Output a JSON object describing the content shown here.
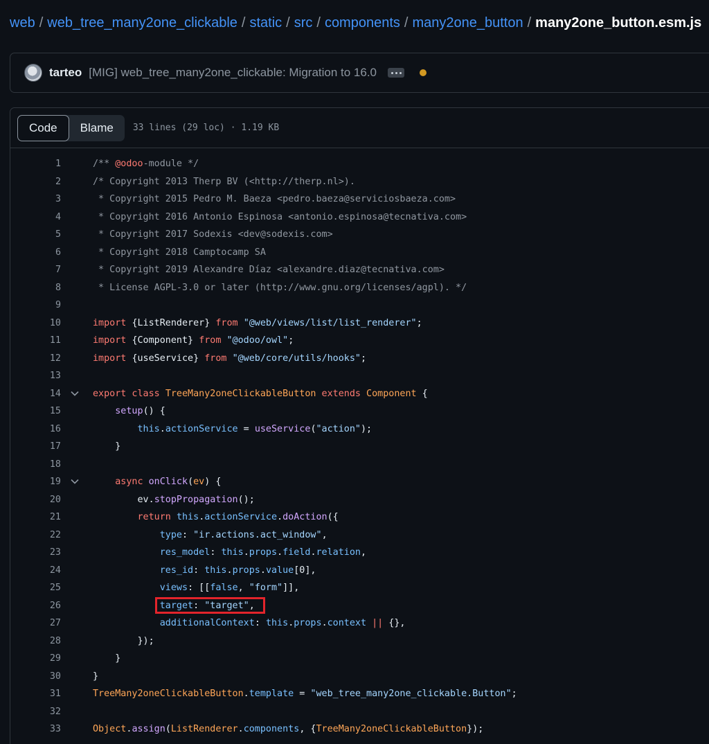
{
  "breadcrumb": [
    {
      "label": "web",
      "link": true
    },
    {
      "label": "web_tree_many2one_clickable",
      "link": true
    },
    {
      "label": "static",
      "link": true
    },
    {
      "label": "src",
      "link": true
    },
    {
      "label": "components",
      "link": true
    },
    {
      "label": "many2one_button",
      "link": true
    },
    {
      "label": "many2one_button.esm.js",
      "link": false
    }
  ],
  "breadcrumb_separator": "/",
  "commit": {
    "author": "tarteo",
    "message": "[MIG] web_tree_many2one_clickable: Migration to 16.0",
    "status_color": "#d29922"
  },
  "file_header": {
    "tabs": [
      "Code",
      "Blame"
    ],
    "active_tab": "Code",
    "meta": "33 lines (29 loc) · 1.19 KB"
  },
  "highlight": {
    "line": 26,
    "color": "#e3242b"
  },
  "code_lines": [
    {
      "n": "1",
      "fold": false,
      "tokens": [
        [
          "c",
          "/** "
        ],
        [
          "k",
          "@odoo"
        ],
        [
          "c",
          "-module */"
        ]
      ]
    },
    {
      "n": "2",
      "fold": false,
      "tokens": [
        [
          "c",
          "/* Copyright 2013 Therp BV (<http://therp.nl>)."
        ]
      ]
    },
    {
      "n": "3",
      "fold": false,
      "tokens": [
        [
          "c",
          " * Copyright 2015 Pedro M. Baeza <pedro.baeza@serviciosbaeza.com>"
        ]
      ]
    },
    {
      "n": "4",
      "fold": false,
      "tokens": [
        [
          "c",
          " * Copyright 2016 Antonio Espinosa <antonio.espinosa@tecnativa.com>"
        ]
      ]
    },
    {
      "n": "5",
      "fold": false,
      "tokens": [
        [
          "c",
          " * Copyright 2017 Sodexis <dev@sodexis.com>"
        ]
      ]
    },
    {
      "n": "6",
      "fold": false,
      "tokens": [
        [
          "c",
          " * Copyright 2018 Camptocamp SA"
        ]
      ]
    },
    {
      "n": "7",
      "fold": false,
      "tokens": [
        [
          "c",
          " * Copyright 2019 Alexandre Díaz <alexandre.diaz@tecnativa.com>"
        ]
      ]
    },
    {
      "n": "8",
      "fold": false,
      "tokens": [
        [
          "c",
          " * License AGPL-3.0 or later (http://www.gnu.org/licenses/agpl). */"
        ]
      ]
    },
    {
      "n": "9",
      "fold": false,
      "tokens": []
    },
    {
      "n": "10",
      "fold": false,
      "tokens": [
        [
          "k",
          "import "
        ],
        [
          "d",
          "{ListRenderer} "
        ],
        [
          "k",
          "from "
        ],
        [
          "s",
          "\"@web/views/list/list_renderer\""
        ],
        [
          "d",
          ";"
        ]
      ]
    },
    {
      "n": "11",
      "fold": false,
      "tokens": [
        [
          "k",
          "import "
        ],
        [
          "d",
          "{Component} "
        ],
        [
          "k",
          "from "
        ],
        [
          "s",
          "\"@odoo/owl\""
        ],
        [
          "d",
          ";"
        ]
      ]
    },
    {
      "n": "12",
      "fold": false,
      "tokens": [
        [
          "k",
          "import "
        ],
        [
          "d",
          "{useService} "
        ],
        [
          "k",
          "from "
        ],
        [
          "s",
          "\"@web/core/utils/hooks\""
        ],
        [
          "d",
          ";"
        ]
      ]
    },
    {
      "n": "13",
      "fold": false,
      "tokens": []
    },
    {
      "n": "14",
      "fold": true,
      "tokens": [
        [
          "k",
          "export class "
        ],
        [
          "e",
          "TreeMany2oneClickableButton "
        ],
        [
          "k",
          "extends "
        ],
        [
          "e",
          "Component "
        ],
        [
          "d",
          "{"
        ]
      ]
    },
    {
      "n": "15",
      "fold": false,
      "tokens": [
        [
          "d",
          "    "
        ],
        [
          "f",
          "setup"
        ],
        [
          "d",
          "() {"
        ]
      ]
    },
    {
      "n": "16",
      "fold": false,
      "tokens": [
        [
          "d",
          "        "
        ],
        [
          "p",
          "this"
        ],
        [
          "d",
          "."
        ],
        [
          "p",
          "actionService"
        ],
        [
          "d",
          " = "
        ],
        [
          "f",
          "useService"
        ],
        [
          "d",
          "("
        ],
        [
          "s",
          "\"action\""
        ],
        [
          "d",
          ");"
        ]
      ]
    },
    {
      "n": "17",
      "fold": false,
      "tokens": [
        [
          "d",
          "    }"
        ]
      ]
    },
    {
      "n": "18",
      "fold": false,
      "tokens": []
    },
    {
      "n": "19",
      "fold": true,
      "tokens": [
        [
          "d",
          "    "
        ],
        [
          "k",
          "async "
        ],
        [
          "f",
          "onClick"
        ],
        [
          "d",
          "("
        ],
        [
          "e",
          "ev"
        ],
        [
          "d",
          ") {"
        ]
      ]
    },
    {
      "n": "20",
      "fold": false,
      "tokens": [
        [
          "d",
          "        ev."
        ],
        [
          "f",
          "stopPropagation"
        ],
        [
          "d",
          "();"
        ]
      ]
    },
    {
      "n": "21",
      "fold": false,
      "tokens": [
        [
          "d",
          "        "
        ],
        [
          "k",
          "return "
        ],
        [
          "p",
          "this"
        ],
        [
          "d",
          "."
        ],
        [
          "p",
          "actionService"
        ],
        [
          "d",
          "."
        ],
        [
          "f",
          "doAction"
        ],
        [
          "d",
          "({"
        ]
      ]
    },
    {
      "n": "22",
      "fold": false,
      "tokens": [
        [
          "d",
          "            "
        ],
        [
          "p",
          "type"
        ],
        [
          "d",
          ": "
        ],
        [
          "s",
          "\"ir.actions.act_window\""
        ],
        [
          "d",
          ","
        ]
      ]
    },
    {
      "n": "23",
      "fold": false,
      "tokens": [
        [
          "d",
          "            "
        ],
        [
          "p",
          "res_model"
        ],
        [
          "d",
          ": "
        ],
        [
          "p",
          "this"
        ],
        [
          "d",
          "."
        ],
        [
          "p",
          "props"
        ],
        [
          "d",
          "."
        ],
        [
          "p",
          "field"
        ],
        [
          "d",
          "."
        ],
        [
          "p",
          "relation"
        ],
        [
          "d",
          ","
        ]
      ]
    },
    {
      "n": "24",
      "fold": false,
      "tokens": [
        [
          "d",
          "            "
        ],
        [
          "p",
          "res_id"
        ],
        [
          "d",
          ": "
        ],
        [
          "p",
          "this"
        ],
        [
          "d",
          "."
        ],
        [
          "p",
          "props"
        ],
        [
          "d",
          "."
        ],
        [
          "p",
          "value"
        ],
        [
          "d",
          "[0],"
        ]
      ]
    },
    {
      "n": "25",
      "fold": false,
      "tokens": [
        [
          "d",
          "            "
        ],
        [
          "p",
          "views"
        ],
        [
          "d",
          ": [["
        ],
        [
          "p",
          "false"
        ],
        [
          "d",
          ", "
        ],
        [
          "s",
          "\"form\""
        ],
        [
          "d",
          "]],"
        ]
      ]
    },
    {
      "n": "26",
      "fold": false,
      "tokens": [
        [
          "d",
          "            "
        ],
        [
          "p",
          "target"
        ],
        [
          "d",
          ": "
        ],
        [
          "s",
          "\"target\""
        ],
        [
          "d",
          ","
        ]
      ]
    },
    {
      "n": "27",
      "fold": false,
      "tokens": [
        [
          "d",
          "            "
        ],
        [
          "p",
          "additionalContext"
        ],
        [
          "d",
          ": "
        ],
        [
          "p",
          "this"
        ],
        [
          "d",
          "."
        ],
        [
          "p",
          "props"
        ],
        [
          "d",
          "."
        ],
        [
          "p",
          "context"
        ],
        [
          "d",
          " "
        ],
        [
          "k",
          "||"
        ],
        [
          "d",
          " {},"
        ]
      ]
    },
    {
      "n": "28",
      "fold": false,
      "tokens": [
        [
          "d",
          "        });"
        ]
      ]
    },
    {
      "n": "29",
      "fold": false,
      "tokens": [
        [
          "d",
          "    }"
        ]
      ]
    },
    {
      "n": "30",
      "fold": false,
      "tokens": [
        [
          "d",
          "}"
        ]
      ]
    },
    {
      "n": "31",
      "fold": false,
      "tokens": [
        [
          "e",
          "TreeMany2oneClickableButton"
        ],
        [
          "d",
          "."
        ],
        [
          "p",
          "template"
        ],
        [
          "d",
          " = "
        ],
        [
          "s",
          "\"web_tree_many2one_clickable.Button\""
        ],
        [
          "d",
          ";"
        ]
      ]
    },
    {
      "n": "32",
      "fold": false,
      "tokens": []
    },
    {
      "n": "33",
      "fold": false,
      "tokens": [
        [
          "e",
          "Object"
        ],
        [
          "d",
          "."
        ],
        [
          "f",
          "assign"
        ],
        [
          "d",
          "("
        ],
        [
          "e",
          "ListRenderer"
        ],
        [
          "d",
          "."
        ],
        [
          "p",
          "components"
        ],
        [
          "d",
          ", {"
        ],
        [
          "e",
          "TreeMany2oneClickableButton"
        ],
        [
          "d",
          "});"
        ]
      ]
    }
  ]
}
